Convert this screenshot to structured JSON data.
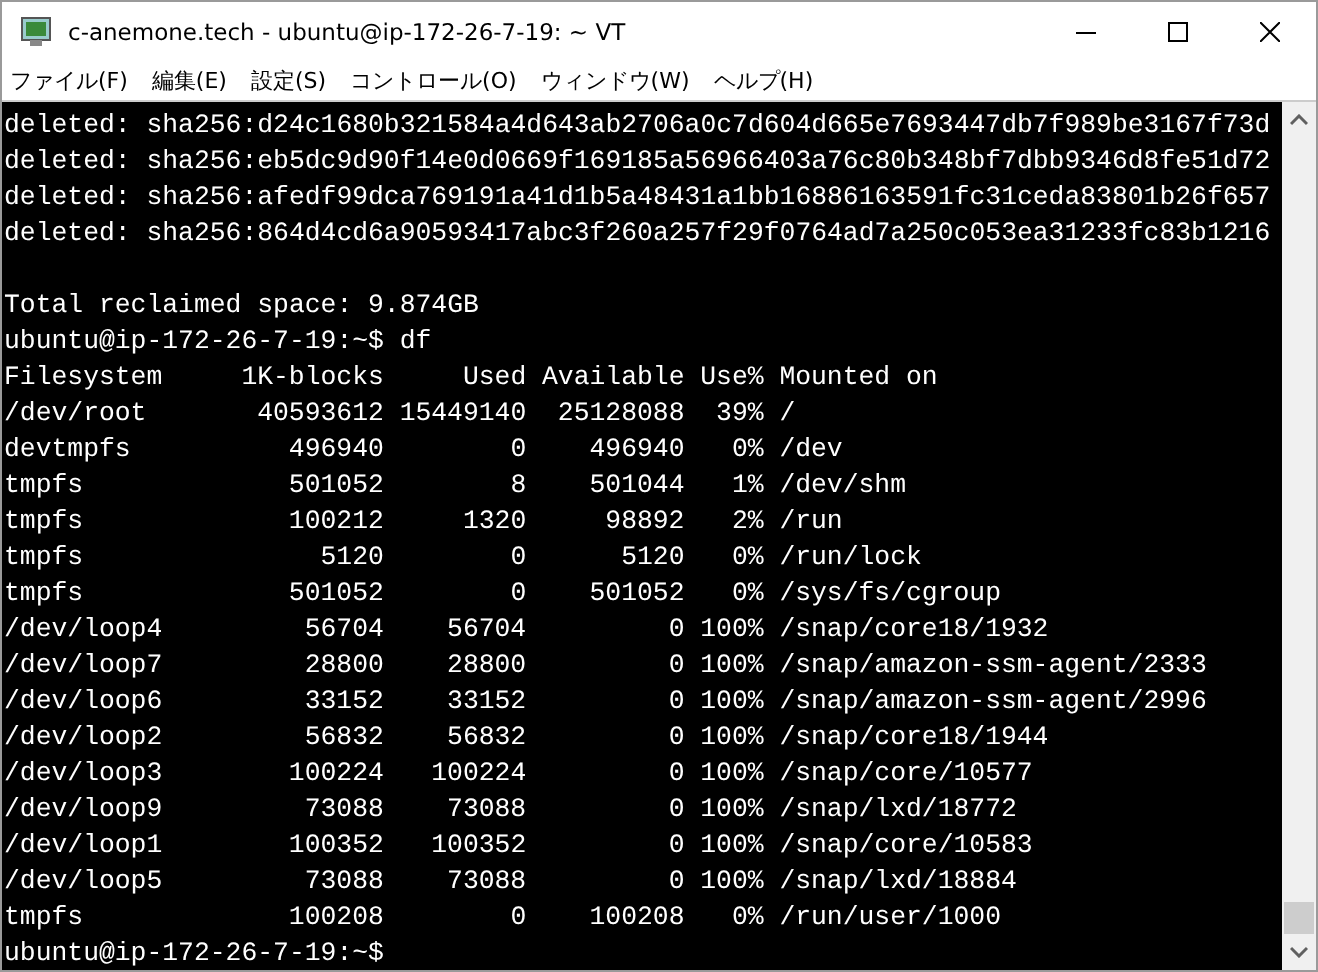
{
  "window": {
    "title": "c-anemone.tech - ubuntu@ip-172-26-7-19: ~ VT"
  },
  "menu": [
    "ファイル(F)",
    "編集(E)",
    "設定(S)",
    "コントロール(O)",
    "ウィンドウ(W)",
    "ヘルプ(H)"
  ],
  "terminal": {
    "deleted_lines": [
      "deleted: sha256:d24c1680b321584a4d643ab2706a0c7d604d665e7693447db7f989be3167f73d",
      "deleted: sha256:eb5dc9d90f14e0d0669f169185a56966403a76c80b348bf7dbb9346d8fe51d72",
      "deleted: sha256:afedf99dca769191a41d1b5a48431a1bb16886163591fc31ceda83801b26f657",
      "deleted: sha256:864d4cd6a90593417abc3f260a257f29f0764ad7a250c053ea31233fc83b1216"
    ],
    "lines_before": [
      "Total reclaimed space: 9.874GB",
      "ubuntu@ip-172-26-7-19:~$ df"
    ],
    "df_table": {
      "columns": [
        "Filesystem",
        "1K-blocks",
        "Used",
        "Available",
        "Use%",
        "Mounted on"
      ],
      "rows": [
        [
          "/dev/root",
          "40593612",
          "15449140",
          "25128088",
          "39%",
          "/"
        ],
        [
          "devtmpfs",
          "496940",
          "0",
          "496940",
          "0%",
          "/dev"
        ],
        [
          "tmpfs",
          "501052",
          "8",
          "501044",
          "1%",
          "/dev/shm"
        ],
        [
          "tmpfs",
          "100212",
          "1320",
          "98892",
          "2%",
          "/run"
        ],
        [
          "tmpfs",
          "5120",
          "0",
          "5120",
          "0%",
          "/run/lock"
        ],
        [
          "tmpfs",
          "501052",
          "0",
          "501052",
          "0%",
          "/sys/fs/cgroup"
        ],
        [
          "/dev/loop4",
          "56704",
          "56704",
          "0",
          "100%",
          "/snap/core18/1932"
        ],
        [
          "/dev/loop7",
          "28800",
          "28800",
          "0",
          "100%",
          "/snap/amazon-ssm-agent/2333"
        ],
        [
          "/dev/loop6",
          "33152",
          "33152",
          "0",
          "100%",
          "/snap/amazon-ssm-agent/2996"
        ],
        [
          "/dev/loop2",
          "56832",
          "56832",
          "0",
          "100%",
          "/snap/core18/1944"
        ],
        [
          "/dev/loop3",
          "100224",
          "100224",
          "0",
          "100%",
          "/snap/core/10577"
        ],
        [
          "/dev/loop9",
          "73088",
          "73088",
          "0",
          "100%",
          "/snap/lxd/18772"
        ],
        [
          "/dev/loop1",
          "100352",
          "100352",
          "0",
          "100%",
          "/snap/core/10583"
        ],
        [
          "/dev/loop5",
          "73088",
          "73088",
          "0",
          "100%",
          "/snap/lxd/18884"
        ],
        [
          "tmpfs",
          "100208",
          "0",
          "100208",
          "0%",
          "/run/user/1000"
        ]
      ]
    },
    "lines_after": [
      "ubuntu@ip-172-26-7-19:~$"
    ]
  }
}
